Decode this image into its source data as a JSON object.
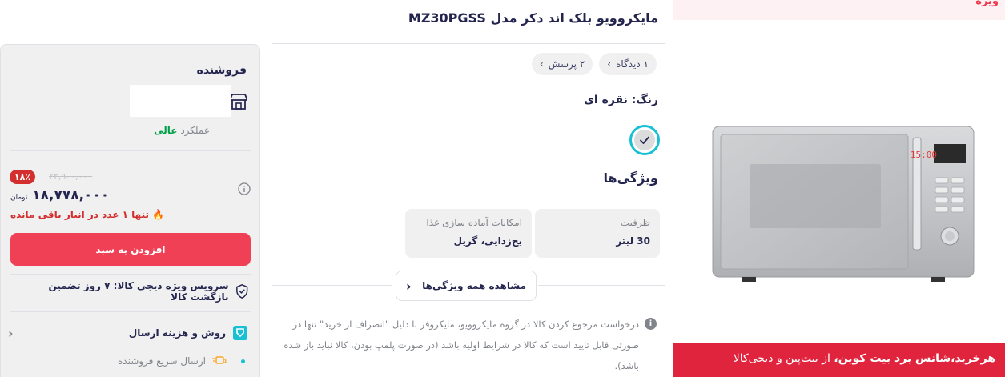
{
  "product": {
    "title": "مایکروویو بلک اند دکر مدل MZ30PGSS",
    "chips": [
      {
        "label": "۱ دیدگاه"
      },
      {
        "label": "۲ پرسش"
      }
    ],
    "color_label": "رنگ: نقره ای",
    "features_heading": "ویژگی‌ها",
    "features": [
      {
        "key": "ظرفیت",
        "value": "30 لیتر"
      },
      {
        "key": "امکانات آماده سازی غذا",
        "value": "یخ‌زدایی، گریل"
      }
    ],
    "see_all_label": "مشاهده همه ویژگی‌ها",
    "notice": "درخواست مرجوع کردن کالا در گروه مایکروویو، مایکروفر با دلیل \"انصراف از خرید\" تنها در صورتی قابل تایید است که کالا در شرایط اولیه باشد (در صورت پلمپ بودن، کالا نباید باز شده باشد)."
  },
  "promo": {
    "top_label": "ویژه",
    "bottom_bold": "هرخرید،شانس برد بیت کوین،",
    "bottom_rest": " از بیت‌پین و دیجی‌کالا"
  },
  "seller": {
    "heading": "فروشنده",
    "performance_label": "عملکرد",
    "performance_value": "عالی",
    "discount": "۱۸٪",
    "old_price": "۲۲,۹۰۰,۰۰۰",
    "price": "۱۸,۷۷۸,۰۰۰",
    "currency": "تومان",
    "stock": "تنها ۱ عدد در انبار باقی مانده",
    "add_to_cart": "افزودن به سبد",
    "guarantee": "سرویس ویژه دیجی کالا: ۷ روز تضمین بازگشت کالا",
    "shipping": "روش و هزینه ارسال",
    "fast_shipping": "ارسال سریع فروشنده"
  },
  "colors": {
    "accent": "#ef4056",
    "selected_ring": "#19bfd3",
    "success": "#00a049",
    "danger": "#d32f2f"
  }
}
